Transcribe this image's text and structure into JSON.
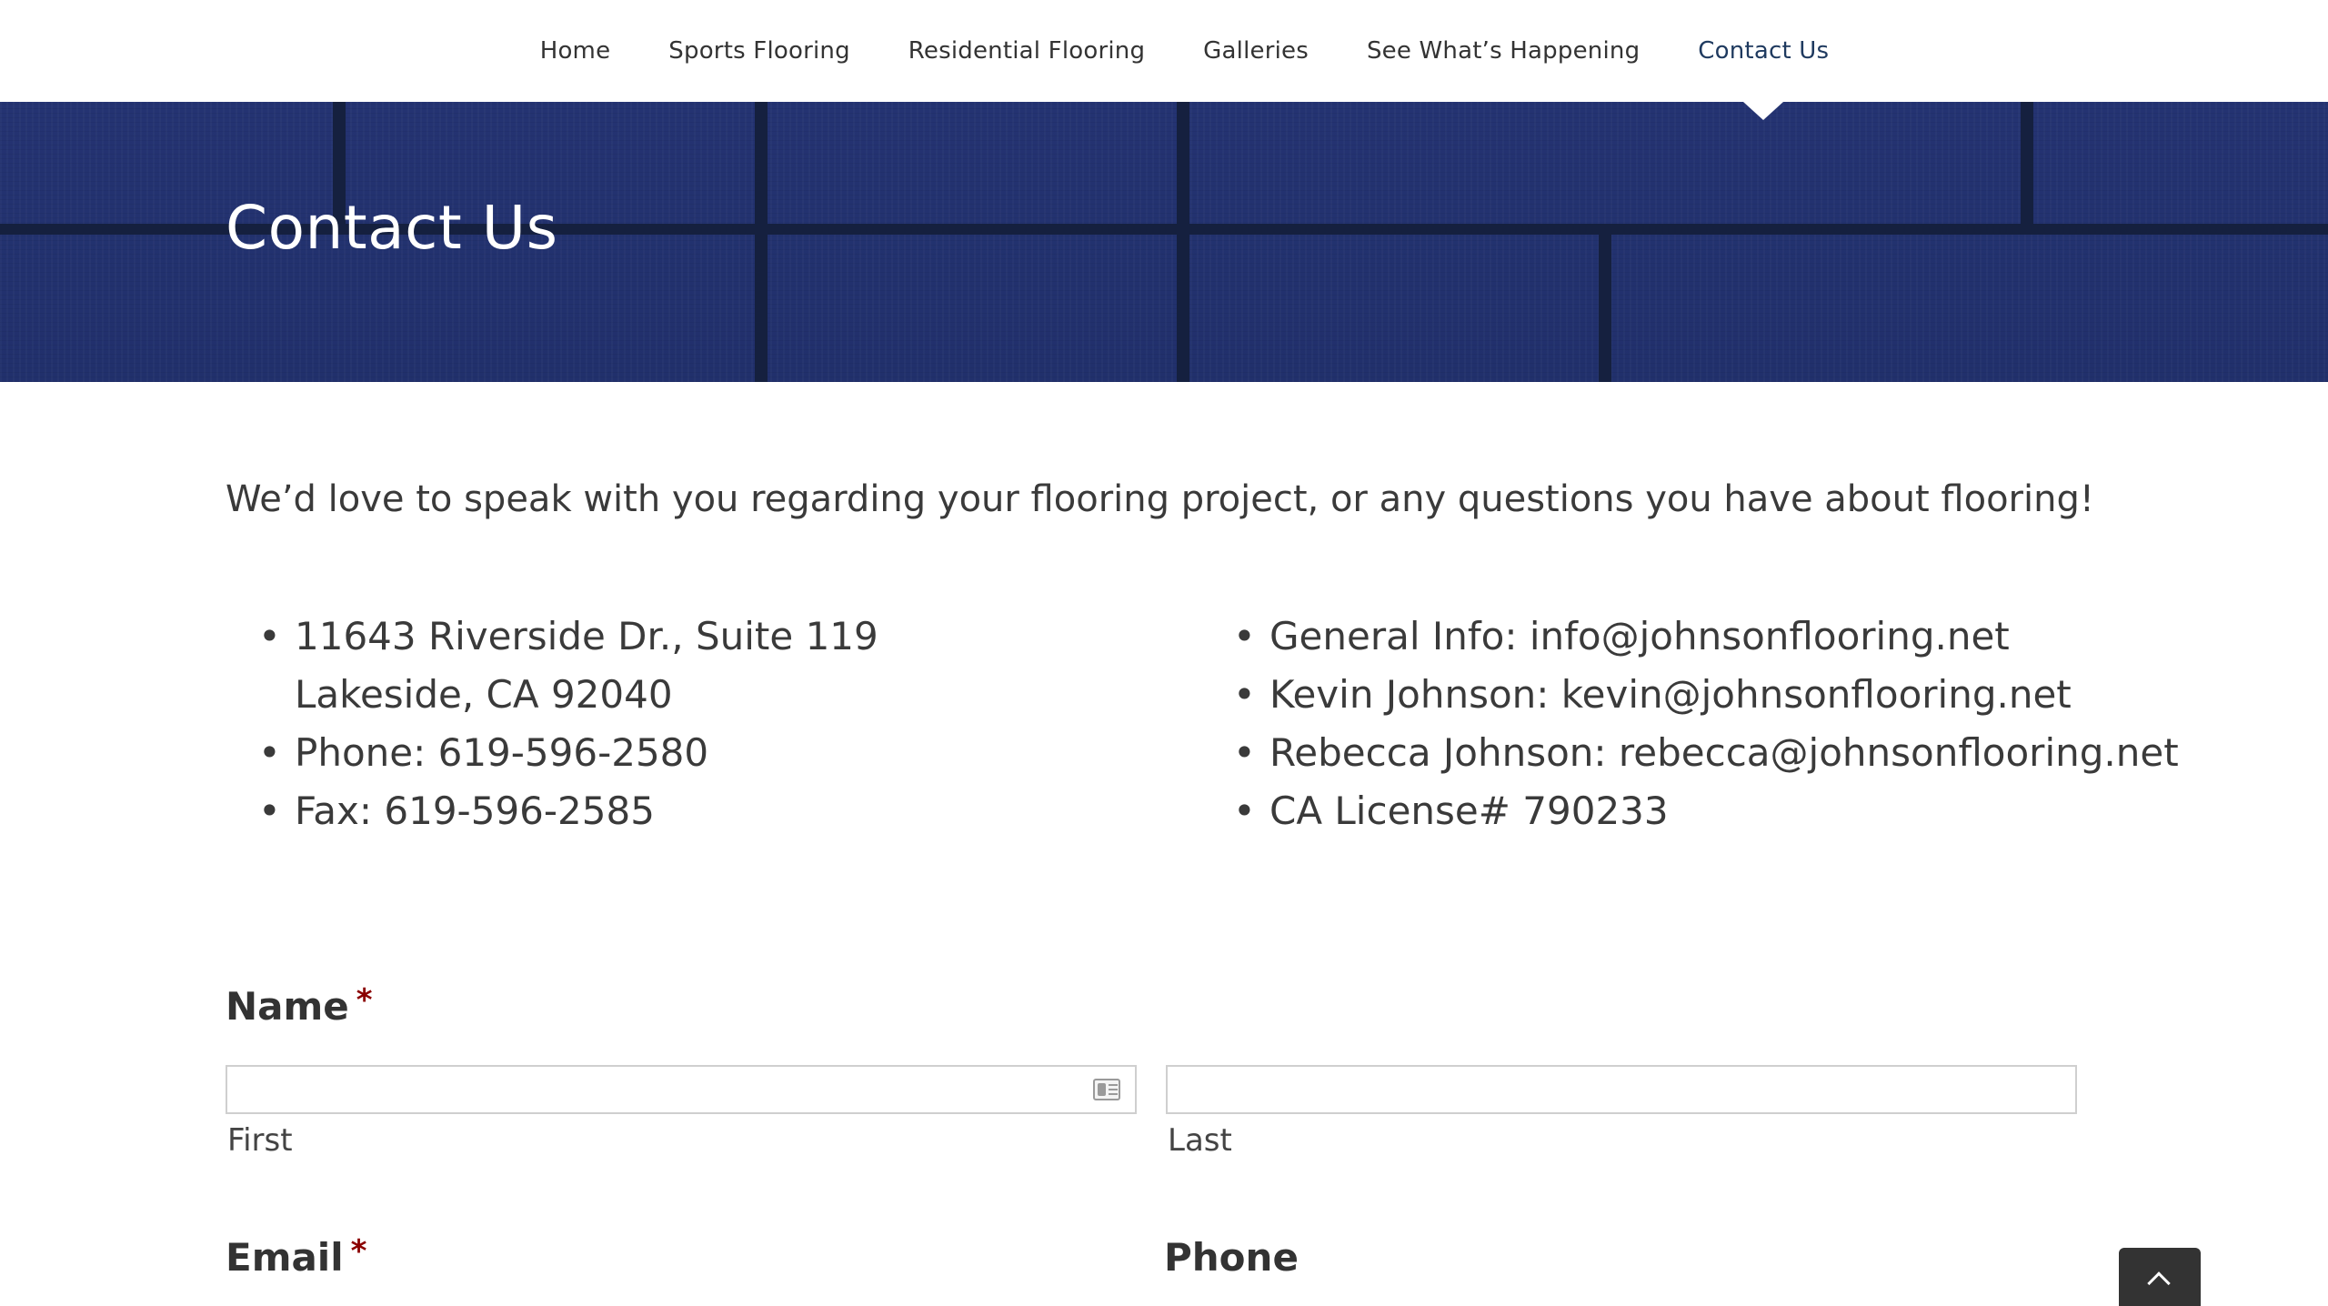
{
  "nav": {
    "items": [
      {
        "label": "Home"
      },
      {
        "label": "Sports Flooring"
      },
      {
        "label": "Residential Flooring"
      },
      {
        "label": "Galleries"
      },
      {
        "label": "See What’s Happening"
      },
      {
        "label": "Contact Us",
        "active": true
      }
    ]
  },
  "banner": {
    "title": "Contact Us"
  },
  "intro": "We’d love to speak with you regarding your flooring project, or any questions you have about flooring!",
  "contact_left": {
    "address_line1": "11643 Riverside Dr., Suite 119",
    "address_line2": "Lakeside, CA 92040",
    "phone": "Phone: 619-596-2580",
    "fax": "Fax: 619-596-2585"
  },
  "contact_right": {
    "general": "General Info: info@johnsonflooring.net",
    "kevin": "Kevin Johnson: kevin@johnsonflooring.net",
    "rebecca": "Rebecca Johnson: rebecca@johnsonflooring.net",
    "license": "CA License# 790233"
  },
  "form": {
    "name_label": "Name",
    "required_mark": "*",
    "first_value": "",
    "first_sublabel": "First",
    "last_value": "",
    "last_sublabel": "Last",
    "email_label": "Email",
    "phone_label": "Phone"
  },
  "icons": {
    "bullet": "•",
    "contact_card": "contact-card-icon",
    "back_to_top": "chevron-up-icon"
  },
  "colors": {
    "banner_blue": "#233170",
    "nav_active": "#1f3a5f",
    "required": "#8b0000"
  }
}
